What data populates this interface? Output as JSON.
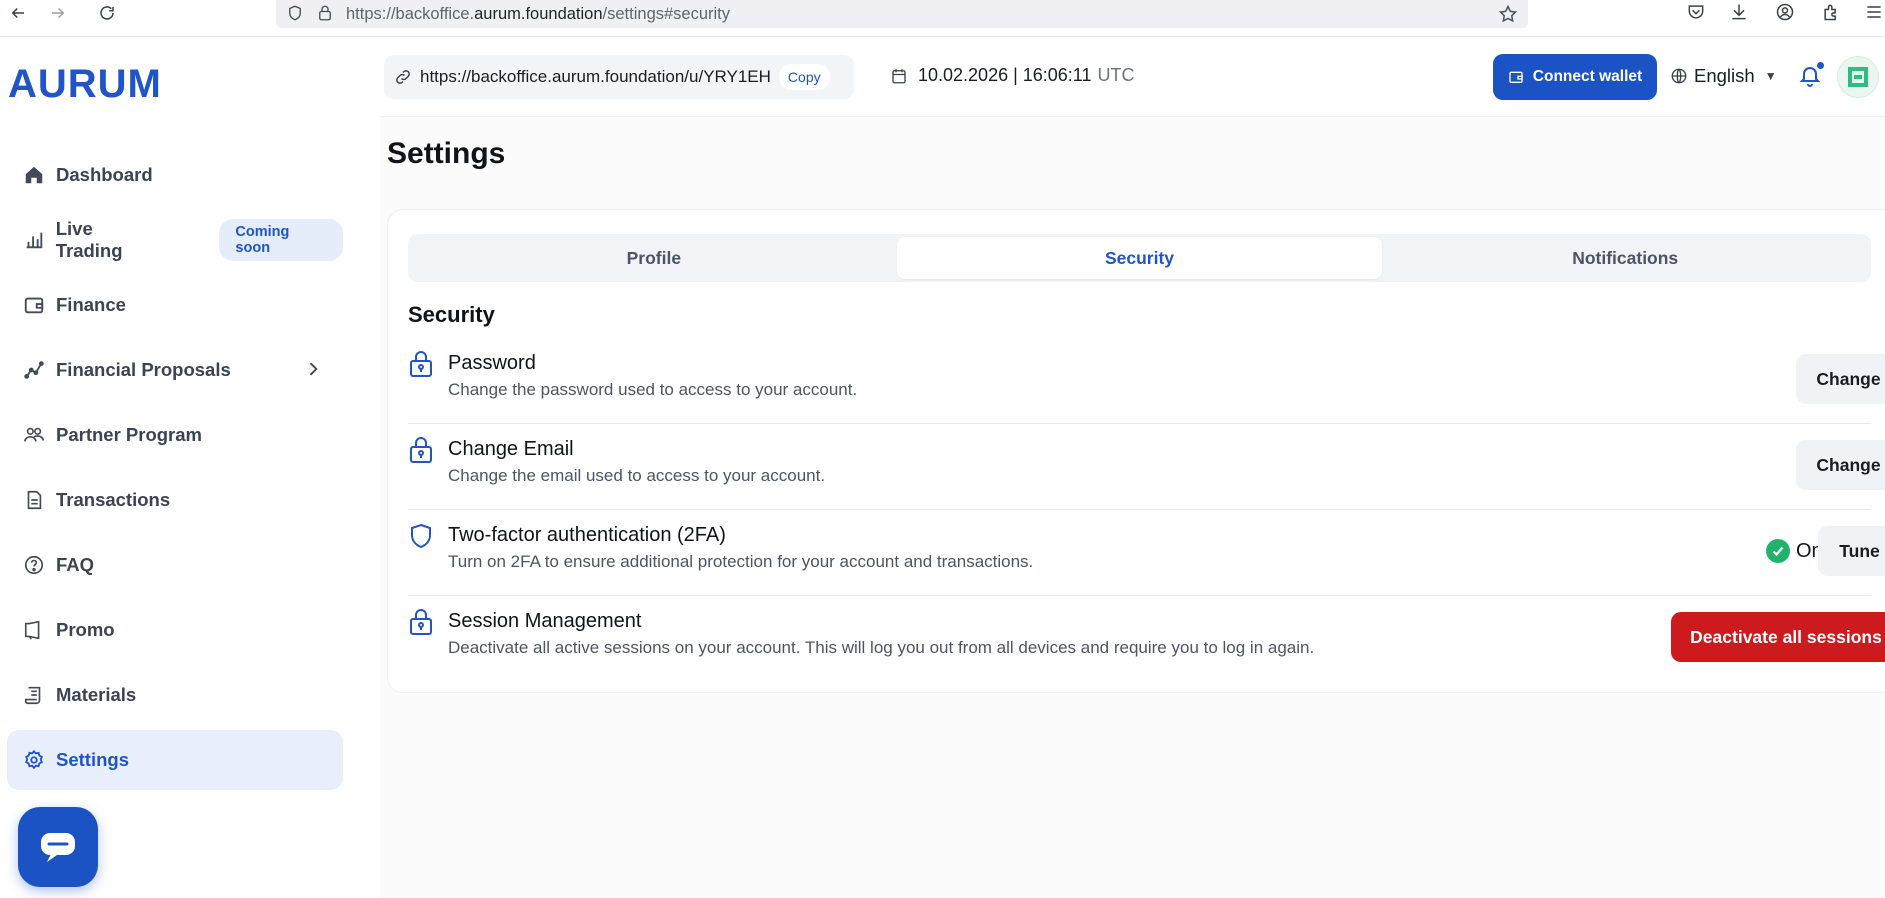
{
  "browser": {
    "url_prefix": "https://backoffice.",
    "url_domain": "aurum.foundation",
    "url_suffix": "/settings#security"
  },
  "sidebar": {
    "logo": "AURUM",
    "items": [
      {
        "label": "Dashboard",
        "icon": "home-icon"
      },
      {
        "label": "Live Trading",
        "icon": "bar-chart-icon",
        "badge": "Coming soon"
      },
      {
        "label": "Finance",
        "icon": "wallet-icon"
      },
      {
        "label": "Financial Proposals",
        "icon": "trend-line-icon"
      },
      {
        "label": "Partner Program",
        "icon": "users-icon"
      },
      {
        "label": "Transactions",
        "icon": "document-icon"
      },
      {
        "label": "FAQ",
        "icon": "question-icon"
      },
      {
        "label": "Promo",
        "icon": "megaphone-icon"
      },
      {
        "label": "Materials",
        "icon": "scroll-icon"
      },
      {
        "label": "Settings",
        "icon": "gear-icon",
        "active": true
      }
    ]
  },
  "header": {
    "referral_link": "https://backoffice.aurum.foundation/u/YRY1EH",
    "copy_label": "Copy",
    "datetime": "10.02.2026 | 16:06:11",
    "timezone": "UTC",
    "connect_wallet": "Connect wallet",
    "language": "English"
  },
  "page": {
    "title": "Settings",
    "tabs": [
      {
        "label": "Profile"
      },
      {
        "label": "Security",
        "active": true
      },
      {
        "label": "Notifications"
      }
    ],
    "section_title": "Security",
    "rows": [
      {
        "title": "Password",
        "desc": "Change the password used to access to your account.",
        "button": "Change",
        "icon": "lock-icon"
      },
      {
        "title": "Change Email",
        "desc": "Change the email used to access to your account.",
        "button": "Change",
        "icon": "lock-icon"
      },
      {
        "title": "Two-factor authentication (2FA)",
        "desc": "Turn on 2FA to ensure additional protection for your account and transactions.",
        "status": "On",
        "button": "Tune",
        "icon": "shield-icon"
      },
      {
        "title": "Session Management",
        "desc": "Deactivate all active sessions on your account. This will log you out from all devices and require you to log in again.",
        "button": "Deactivate all sessions",
        "icon": "lock-icon"
      }
    ]
  },
  "colors": {
    "brand": "#1f55c9",
    "danger": "#cc1a1f",
    "success": "#1fb36b"
  }
}
